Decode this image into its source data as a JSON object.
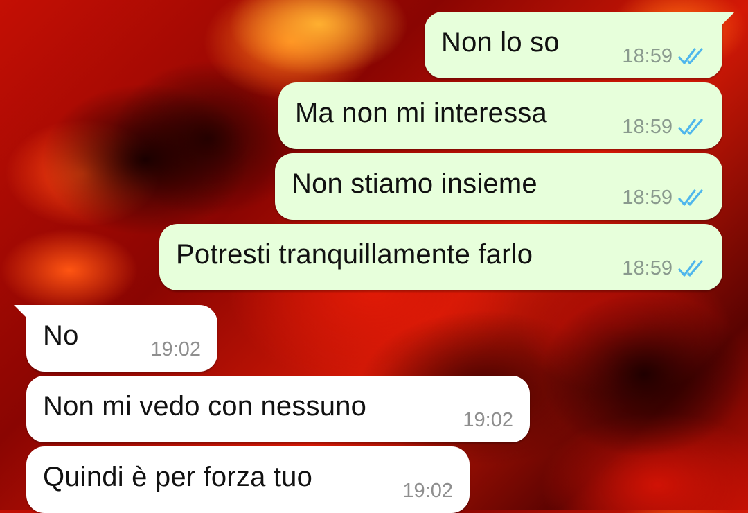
{
  "chat": {
    "messages": [
      {
        "direction": "outgoing",
        "text": "Non lo so",
        "time": "18:59",
        "status": "read"
      },
      {
        "direction": "outgoing",
        "text": "Ma non mi interessa",
        "time": "18:59",
        "status": "read"
      },
      {
        "direction": "outgoing",
        "text": "Non stiamo insieme",
        "time": "18:59",
        "status": "read"
      },
      {
        "direction": "outgoing",
        "text": "Potresti tranquillamente farlo",
        "time": "18:59",
        "status": "read"
      },
      {
        "direction": "incoming",
        "text": "No",
        "time": "19:02"
      },
      {
        "direction": "incoming",
        "text": "Non mi vedo con nessuno",
        "time": "19:02"
      },
      {
        "direction": "incoming",
        "text": "Quindi è per forza tuo",
        "time": "19:02"
      }
    ]
  },
  "colors": {
    "outgoing_bubble": "#e7ffdb",
    "incoming_bubble": "#ffffff",
    "read_ticks": "#4fb6ec"
  },
  "icons": {
    "read_status": "double-check-icon"
  }
}
